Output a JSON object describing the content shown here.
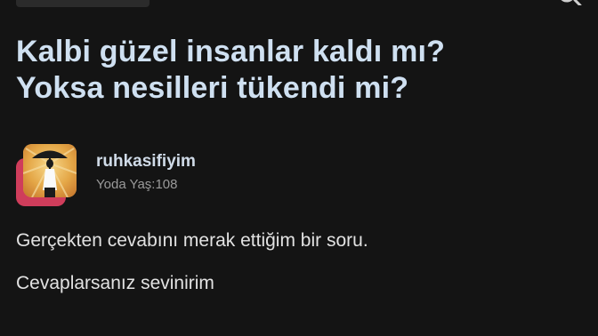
{
  "post": {
    "title_lines": [
      "Kalbi güzel insanlar kaldı mı?",
      "Yoksa nesilleri tükendi mi?"
    ],
    "author": {
      "name": "ruhkasifiyim",
      "meta": "Yoda Yaş:108"
    },
    "body": [
      "Gerçekten cevabını merak ettiğim bir soru.",
      "Cevaplarsanız sevinirim"
    ]
  },
  "colors": {
    "background": "#141414",
    "title": "#cfe0f1",
    "author_name": "#d0dbe8",
    "meta": "#9a9a9a",
    "body_text": "#e2e2e2",
    "avatar_accent": "#cf3d5b",
    "avatar_background": "#e7b14e"
  },
  "icons": {
    "top_right": "search-icon"
  }
}
